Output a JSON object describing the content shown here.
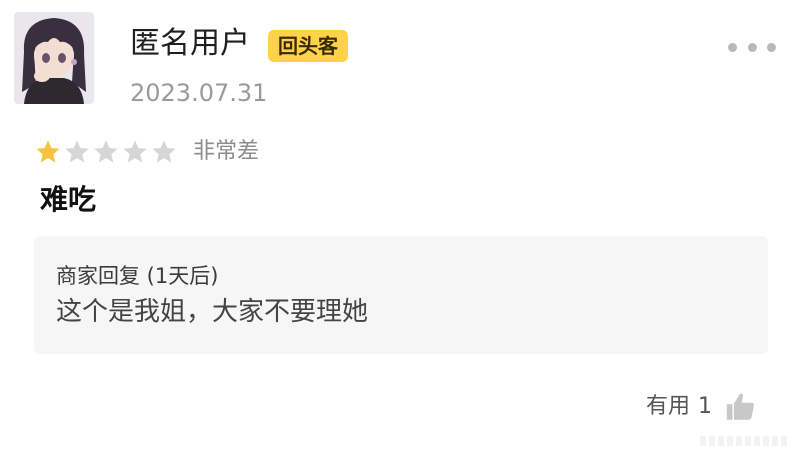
{
  "review": {
    "username": "匿名用户",
    "badge": "回头客",
    "date": "2023.07.31",
    "rating_stars_filled": 1,
    "rating_stars_total": 5,
    "rating_label": "非常差",
    "text": "难吃"
  },
  "merchant_reply": {
    "header": "商家回复 (1天后)",
    "text": "这个是我姐，大家不要理她"
  },
  "helpful": {
    "label": "有用",
    "count": "1"
  },
  "colors": {
    "badge_bg": "#ffd24a",
    "star_filled": "#f6c343",
    "star_empty": "#d6d6d6",
    "reply_bg": "#f6f6f6"
  },
  "icons": [
    "avatar",
    "more-icon",
    "star-icon",
    "thumbs-up-icon"
  ]
}
